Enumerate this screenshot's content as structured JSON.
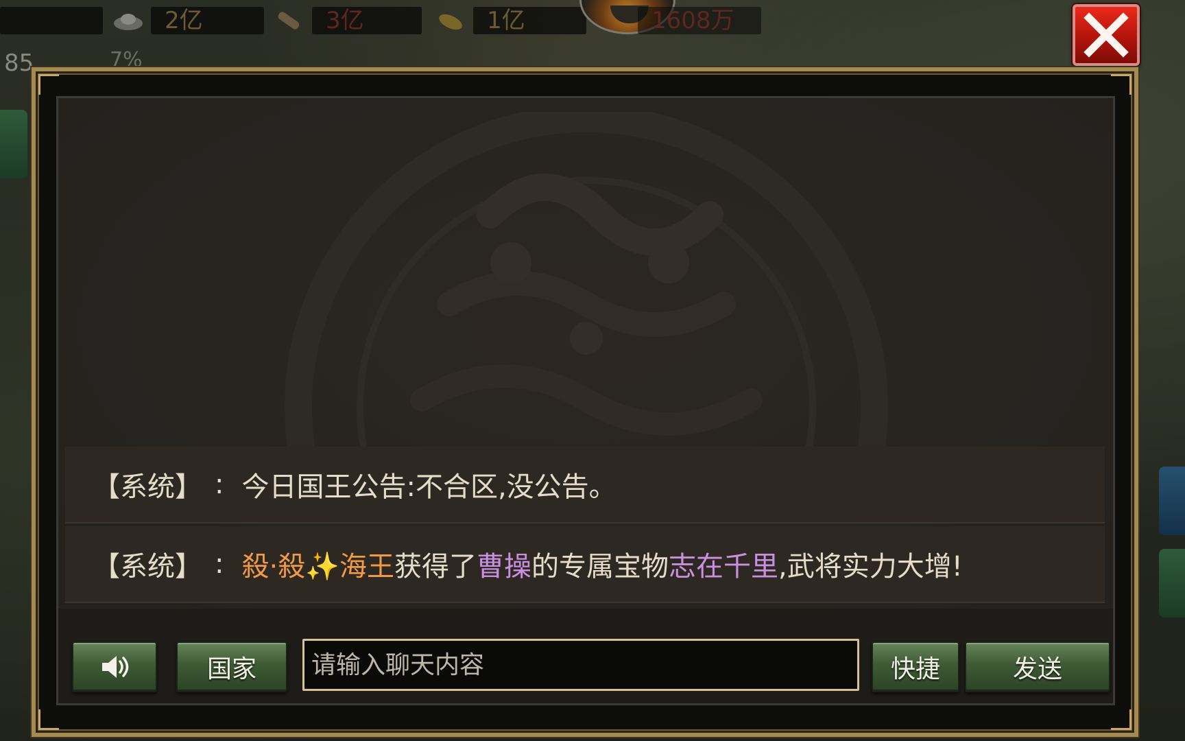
{
  "resources": [
    {
      "icon": "silver-ingot-icon",
      "value": "2亿"
    },
    {
      "icon": "wood-log-icon",
      "value": "3亿"
    },
    {
      "icon": "grain-icon",
      "value": "1亿"
    },
    {
      "icon": "troops-icon",
      "value": "1608万"
    }
  ],
  "player": {
    "level": "85",
    "progress": "7%"
  },
  "chat": {
    "messages": [
      {
        "channel": "【系统】",
        "separator": ":",
        "text": "今日国王公告:不合区,没公告。"
      },
      {
        "channel": "【系统】",
        "separator": ":",
        "player_part1": "殺·殺",
        "sparkle": "✨",
        "player_part2": "海王",
        "text_a": "获得了",
        "general": "曹操",
        "text_b": "的专属宝物",
        "treasure": "志在千里",
        "text_c": ",武将实力大增!"
      }
    ],
    "buttons": {
      "voice_icon": "speaker-icon",
      "country": "国家",
      "quick": "快捷",
      "send": "发送"
    },
    "input": {
      "placeholder": "请输入聊天内容",
      "value": ""
    }
  },
  "colors": {
    "frame_gold": "#a58a52",
    "player_name": "#f09a46",
    "item_purple": "#c98fe0",
    "button_green": "#3e5a35",
    "close_red": "#d8281a"
  }
}
